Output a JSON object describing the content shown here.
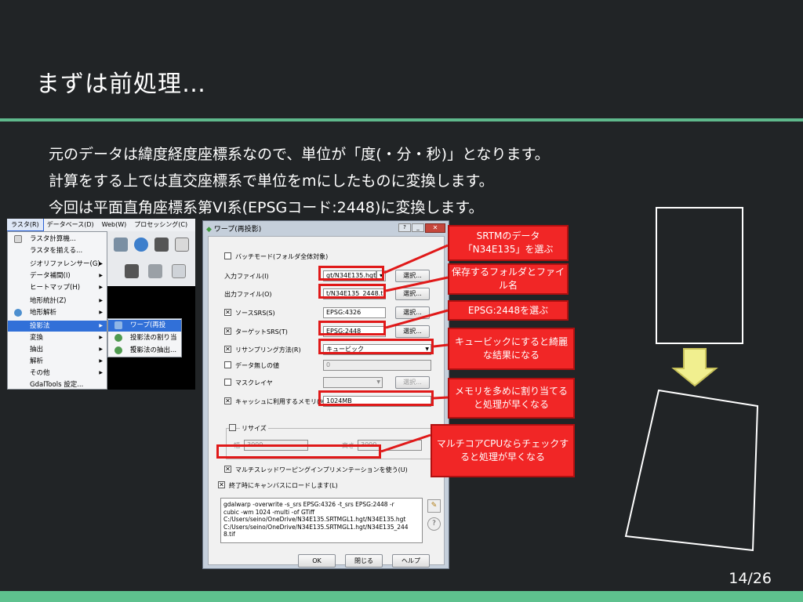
{
  "slide": {
    "title": "まずは前処理…",
    "body_lines": [
      "元のデータは緯度経度座標系なので、単位が「度(・分・秒)」となります。",
      "計算をする上では直交座標系で単位をmにしたものに変換します。",
      "今回は平面直角座標系第VI系(EPSGコード:2448)に変換します。"
    ],
    "page_number": "14/26"
  },
  "qgis_menu": {
    "menubar": [
      "ラスタ(R)",
      "データベース(D)",
      "Web(W)",
      "プロセッシング(C)"
    ],
    "items": [
      {
        "label": "ラスタ計算機...",
        "arrow": ""
      },
      {
        "label": "ラスタを揃える...",
        "arrow": ""
      },
      {
        "label": "ジオリファレンサー(G)",
        "arrow": "▶"
      },
      {
        "label": "データ補間(I)",
        "arrow": "▶"
      },
      {
        "label": "ヒートマップ(H)",
        "arrow": "▶"
      },
      {
        "label": "地形統計(Z)",
        "arrow": "▶"
      },
      {
        "label": "地形解析",
        "arrow": "▶"
      },
      {
        "label": "投影法",
        "arrow": "▶"
      },
      {
        "label": "変換",
        "arrow": "▶"
      },
      {
        "label": "抽出",
        "arrow": "▶"
      },
      {
        "label": "解析",
        "arrow": "▶"
      },
      {
        "label": "その他",
        "arrow": "▶"
      },
      {
        "label": "GdalTools 設定...",
        "arrow": ""
      }
    ],
    "submenu": [
      "ワープ(再投影)...",
      "投影法の割り当て...",
      "投影法の抽出..."
    ]
  },
  "dialog": {
    "title": "ワープ(再投影)",
    "batch_mode": "バッチモード(フォルダ全体対象)",
    "input_label": "入力ファイル(I)",
    "input_value": "gt/N34E135.hgt",
    "output_label": "出力ファイル(O)",
    "output_value": "t/N34E135_2448.tif",
    "source_srs_label": "ソースSRS(S)",
    "source_srs_value": "EPSG:4326",
    "target_srs_label": "ターゲットSRS(T)",
    "target_srs_value": "EPSG:2448",
    "resampling_label": "リサンプリング方法(R)",
    "resampling_value": "キュービック",
    "no_data_label": "データ無しの値",
    "no_data_value": "0",
    "mask_label": "マスクレイヤ",
    "cache_label": "キャッシュに利用するメモリ(M)",
    "cache_value": "1024MB",
    "resize_label": "リサイズ",
    "width_label": "幅",
    "width_value": "3000",
    "height_label": "高さ",
    "height_value": "3000",
    "multithread_label": "マルチスレッドワーピングインプリメンテーションを使う(U)",
    "load_canvas_label": "終了時にキャンバスにロードします(L)",
    "browse_label": "選択...",
    "command": "gdalwarp -overwrite -s_srs EPSG:4326 -t_srs EPSG:2448 -r\ncubic -wm 1024 -multi -of GTiff\nC:/Users/seino/OneDrive/N34E135.SRTMGL1.hgt/N34E135.hgt\nC:/Users/seino/OneDrive/N34E135.SRTMGL1.hgt/N34E135_244\n8.tif",
    "ok_label": "OK",
    "close_label": "閉じる",
    "help_label": "ヘルプ"
  },
  "callouts": [
    "SRTMのデータ「N34E135」を選ぶ",
    "保存するフォルダとファイル名",
    "EPSG:2448を選ぶ",
    "キュービックにすると綺麗な結果になる",
    "メモリを多めに割り当てると処理が早くなる",
    "マルチコアCPUならチェックすると処理が早くなる"
  ],
  "colors": {
    "background": "#212426",
    "accent_green": "#5fb98c",
    "callout_red": "#f12626",
    "arrow_yellow": "#f1ef8f"
  }
}
